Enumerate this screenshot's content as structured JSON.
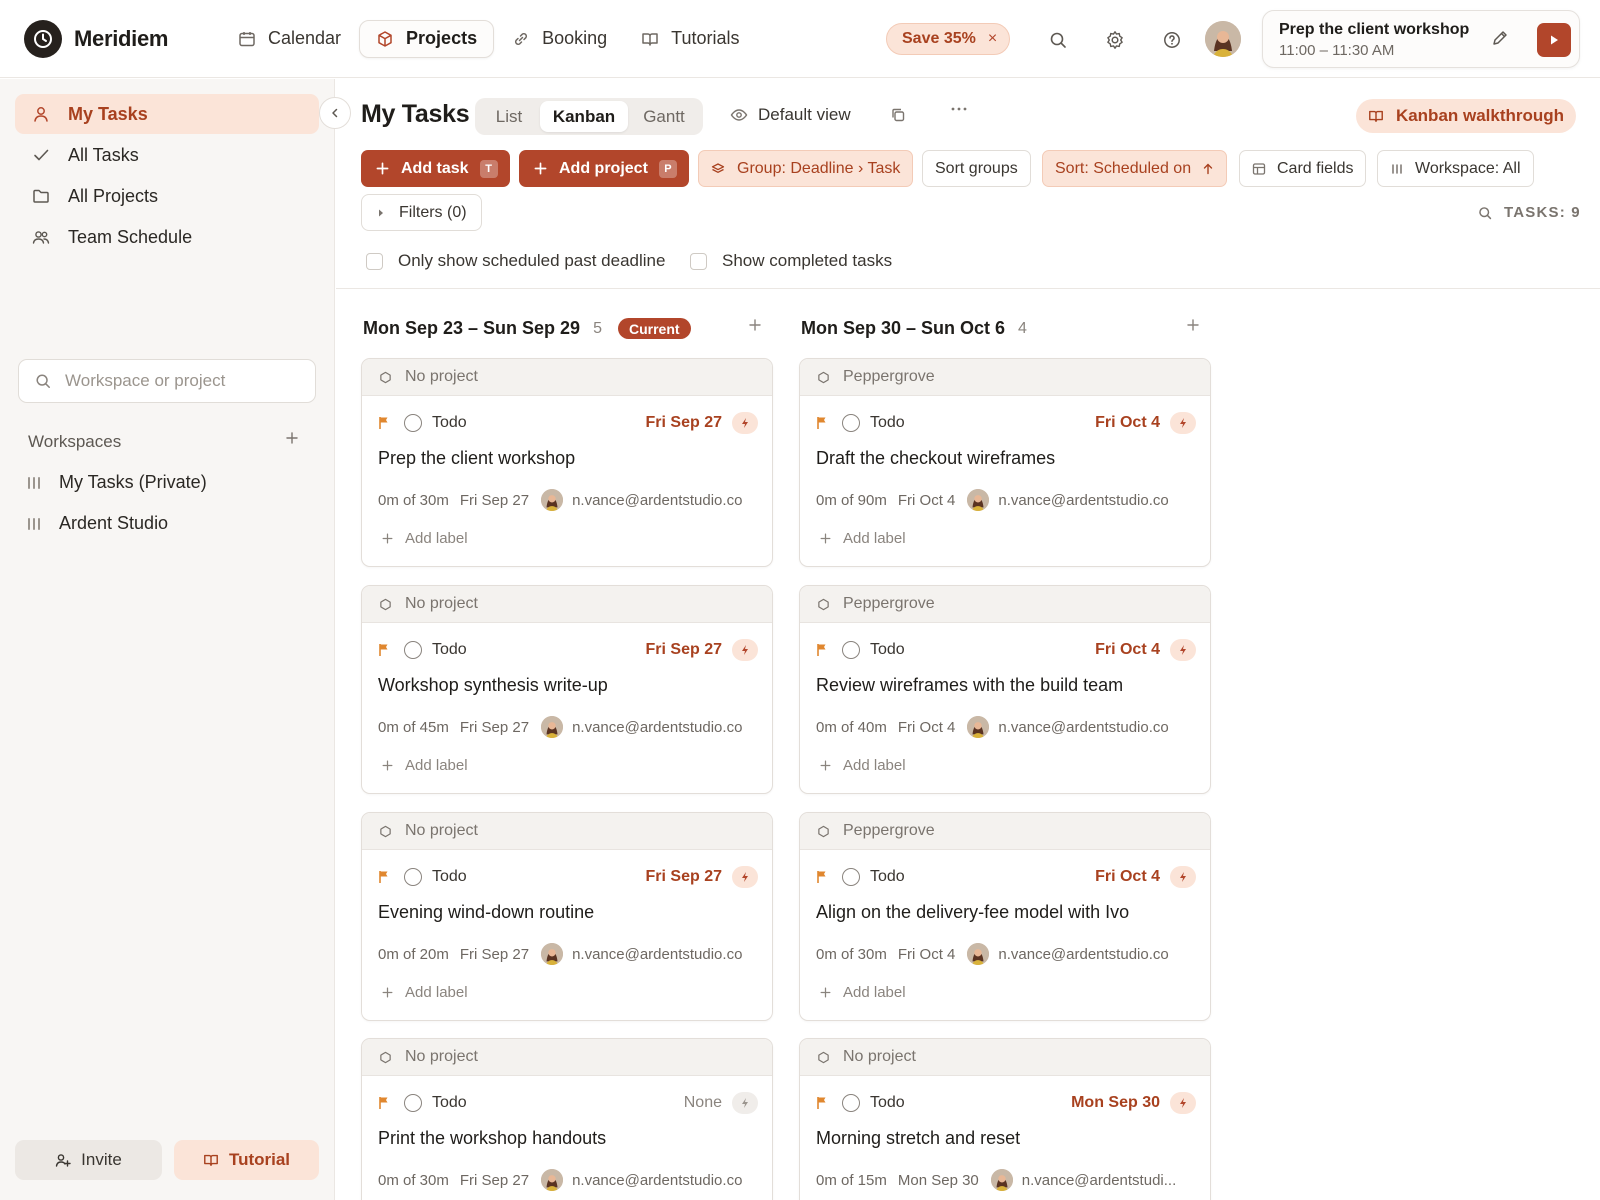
{
  "app": {
    "name": "Meridiem",
    "nav": [
      {
        "label": "Calendar",
        "icon": "calendar-icon"
      },
      {
        "label": "Projects",
        "icon": "cube-icon",
        "active": true
      },
      {
        "label": "Booking",
        "icon": "link-icon"
      },
      {
        "label": "Tutorials",
        "icon": "book-icon"
      }
    ],
    "promo": {
      "label": "Save 35%",
      "close": "×"
    },
    "now_playing": {
      "title": "Prep the client workshop",
      "time": "11:00 – 11:30 AM"
    }
  },
  "sidebar": {
    "items": [
      {
        "label": "My Tasks",
        "icon": "user-icon",
        "active": true
      },
      {
        "label": "All Tasks",
        "icon": "check-icon"
      },
      {
        "label": "All Projects",
        "icon": "folder-icon"
      },
      {
        "label": "Team Schedule",
        "icon": "users-icon"
      }
    ],
    "search_placeholder": "Workspace or project",
    "workspaces_heading": "Workspaces",
    "workspaces": [
      "My Tasks (Private)",
      "Ardent Studio"
    ],
    "invite_label": "Invite",
    "tutorial_label": "Tutorial"
  },
  "main": {
    "title": "My Tasks",
    "view_tabs": [
      {
        "label": "List"
      },
      {
        "label": "Kanban",
        "active": true
      },
      {
        "label": "Gantt"
      }
    ],
    "default_view": "Default view",
    "walkthrough": "Kanban walkthrough",
    "toolbar": {
      "add_task": "Add task",
      "add_task_key": "T",
      "add_project": "Add project",
      "add_project_key": "P",
      "group": "Group: Deadline › Task",
      "sort_groups": "Sort groups",
      "sort": "Sort: Scheduled on",
      "card_fields": "Card fields",
      "workspace": "Workspace: All",
      "filters": "Filters (0)",
      "task_count": "TASKS: 9"
    },
    "options": {
      "past_deadline": "Only show scheduled past deadline",
      "show_completed": "Show completed tasks"
    },
    "add_label": "Add label",
    "columns": [
      {
        "title": "Mon Sep 23 – Sun Sep 29",
        "count": "5",
        "badge": "Current",
        "cards": [
          {
            "project": "No project",
            "status": "Todo",
            "deadline": "Fri Sep 27",
            "title": "Prep the client workshop",
            "duration": "0m of 30m",
            "scheduled": "Fri Sep 27",
            "assignee": "n.vance@ardentstudio.co"
          },
          {
            "project": "No project",
            "status": "Todo",
            "deadline": "Fri Sep 27",
            "title": "Workshop synthesis write-up",
            "duration": "0m of 45m",
            "scheduled": "Fri Sep 27",
            "assignee": "n.vance@ardentstudio.co"
          },
          {
            "project": "No project",
            "status": "Todo",
            "deadline": "Fri Sep 27",
            "title": "Evening wind-down routine",
            "duration": "0m of 20m",
            "scheduled": "Fri Sep 27",
            "assignee": "n.vance@ardentstudio.co"
          },
          {
            "project": "No project",
            "status": "Todo",
            "deadline": "None",
            "title": "Print the workshop handouts",
            "duration": "0m of 30m",
            "scheduled": "Fri Sep 27",
            "assignee": "n.vance@ardentstudio.co"
          }
        ]
      },
      {
        "title": "Mon Sep 30 – Sun Oct 6",
        "count": "4",
        "badge": "",
        "cards": [
          {
            "project": "Peppergrove",
            "status": "Todo",
            "deadline": "Fri Oct 4",
            "title": "Draft the checkout wireframes",
            "duration": "0m of 90m",
            "scheduled": "Fri Oct 4",
            "assignee": "n.vance@ardentstudio.co"
          },
          {
            "project": "Peppergrove",
            "status": "Todo",
            "deadline": "Fri Oct 4",
            "title": "Review wireframes with the build team",
            "duration": "0m of 40m",
            "scheduled": "Fri Oct 4",
            "assignee": "n.vance@ardentstudio.co"
          },
          {
            "project": "Peppergrove",
            "status": "Todo",
            "deadline": "Fri Oct 4",
            "title": "Align on the delivery-fee model with Ivo",
            "duration": "0m of 30m",
            "scheduled": "Fri Oct 4",
            "assignee": "n.vance@ardentstudio.co"
          },
          {
            "project": "No project",
            "status": "Todo",
            "deadline": "Mon Sep 30",
            "title": "Morning stretch and reset",
            "duration": "0m of 15m",
            "scheduled": "Mon Sep 30",
            "assignee": "n.vance@ardentstudi..."
          }
        ]
      }
    ]
  },
  "colors": {
    "accent": "#b2462b",
    "accent_soft": "#fbe4d8",
    "flag": "#e0872f"
  }
}
